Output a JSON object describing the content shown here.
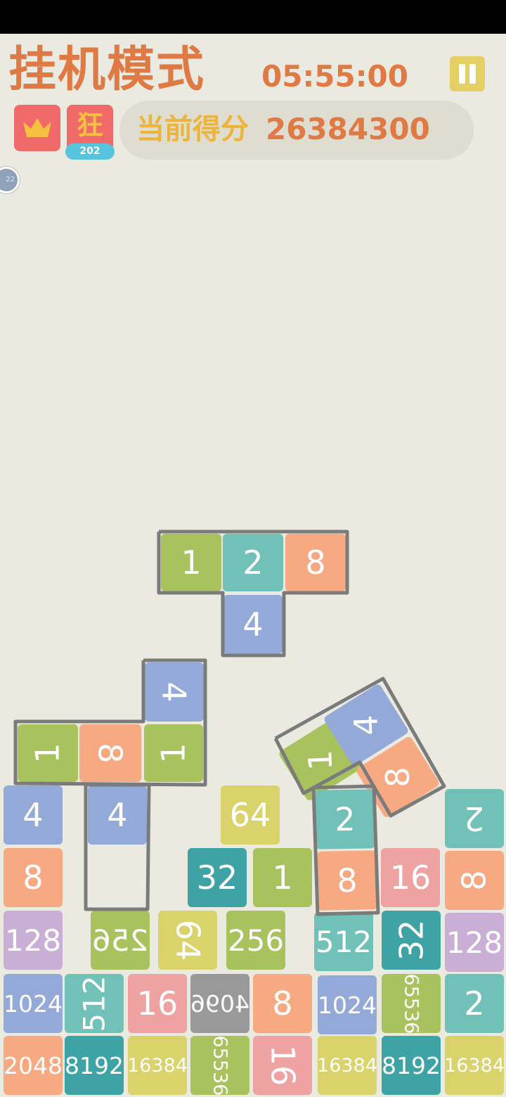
{
  "header": {
    "mode_title": "挂机模式",
    "timer": "05:55:00",
    "rage_label": "狂",
    "rage_count": "202",
    "score_label": "当前得分",
    "score_value": "26384300",
    "side_badge": "22"
  },
  "icons": [
    "pause-icon",
    "crown-icon"
  ],
  "colors": {
    "background": "#ebeae0",
    "accent": "#e07a45",
    "t1": "#a8c25e",
    "t2": "#72c1b8",
    "t4": "#93aad8",
    "t8": "#f7aa82",
    "t16": "#eea2a2",
    "t32": "#3ea3a4",
    "t64": "#dad26a",
    "t128": "#c9afd6",
    "t256": "#a8c25e",
    "t512": "#72c1b8",
    "t1024": "#93aad8",
    "t2048": "#f7aa82",
    "t8192": "#3ea3a4",
    "t16384": "#dad26a",
    "t65536": "#a8c25e"
  },
  "falling_piece": {
    "tiles": [
      "1",
      "2",
      "8",
      "4"
    ]
  },
  "stacked_tiles": [
    "4",
    "1",
    "8",
    "1",
    "4",
    "4",
    "64",
    "8",
    "32",
    "1",
    "1",
    "4",
    "8",
    "2",
    "8",
    "16",
    "2",
    "8",
    "128",
    "256",
    "64",
    "256",
    "512",
    "32",
    "128",
    "1024",
    "512",
    "16",
    "4096",
    "8",
    "1024",
    "65536",
    "2",
    "2048",
    "8192",
    "16384",
    "65536",
    "16",
    "16384",
    "8192",
    "16384"
  ]
}
